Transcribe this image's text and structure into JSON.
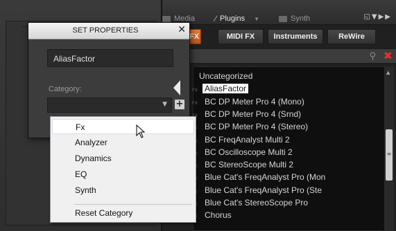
{
  "browser": {
    "tabs": [
      {
        "label": "Media"
      },
      {
        "label": "Plugins"
      },
      {
        "label": "Synth"
      }
    ],
    "category_buttons": [
      {
        "label": "FX"
      },
      {
        "label": "MIDI FX"
      },
      {
        "label": "Instruments"
      },
      {
        "label": "ReWire"
      }
    ],
    "list": [
      {
        "label": "Uncategorized",
        "kind": "category"
      },
      {
        "label": "AliasFactor",
        "kind": "item",
        "selected": true
      },
      {
        "label": "BC DP Meter Pro 4 (Mono)",
        "kind": "item"
      },
      {
        "label": "BC DP Meter Pro 4 (Srnd)",
        "kind": "item"
      },
      {
        "label": "BC DP Meter Pro 4 (Stereo)",
        "kind": "item"
      },
      {
        "label": "BC FreqAnalyst Multi 2",
        "kind": "item"
      },
      {
        "label": "BC Oscilloscope Multi 2",
        "kind": "item"
      },
      {
        "label": "BC StereoScope Multi 2",
        "kind": "item"
      },
      {
        "label": "Blue Cat's FreqAnalyst Pro (Mon",
        "kind": "item"
      },
      {
        "label": "Blue Cat's FreqAnalyst Pro (Ste",
        "kind": "item"
      },
      {
        "label": "Blue Cat's StereoScope Pro",
        "kind": "item"
      },
      {
        "label": "Chorus",
        "kind": "item"
      }
    ],
    "fx_icon_label": "FX",
    "accent_color": "#e06a20",
    "clear_color": "#e03030"
  },
  "dialog": {
    "title": "SET PROPERTIES",
    "name_value": "AliasFactor",
    "category_label": "Category:",
    "category_value": ""
  },
  "menu": {
    "items": [
      {
        "label": "Fx"
      },
      {
        "label": "Analyzer"
      },
      {
        "label": "Dynamics"
      },
      {
        "label": "EQ"
      },
      {
        "label": "Synth"
      },
      {
        "label": "Reset Category"
      }
    ]
  }
}
